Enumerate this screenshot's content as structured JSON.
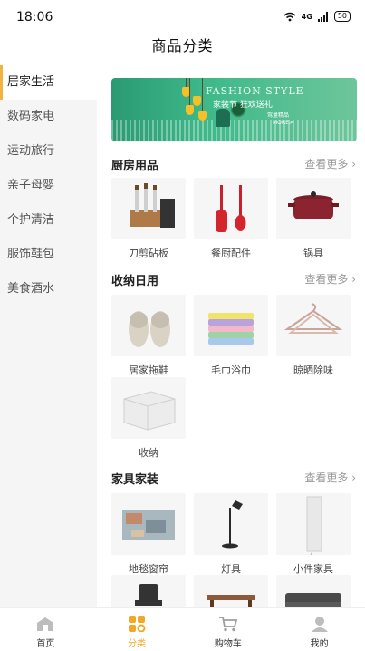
{
  "status_bar": {
    "time": "18:06",
    "signal_text": "4G",
    "battery": "50"
  },
  "header": {
    "title": "商品分类"
  },
  "sidebar": {
    "items": [
      {
        "label": "居家生活",
        "active": true
      },
      {
        "label": "数码家电",
        "active": false
      },
      {
        "label": "运动旅行",
        "active": false
      },
      {
        "label": "亲子母婴",
        "active": false
      },
      {
        "label": "个护清洁",
        "active": false
      },
      {
        "label": "服饰鞋包",
        "active": false
      },
      {
        "label": "美食酒水",
        "active": false
      }
    ]
  },
  "banner": {
    "title_en": "FASHION STYLE",
    "subtitle_cn": "家装节 狂欢送礼",
    "more_line1": "驾量精品",
    "more_line2": "MORE>"
  },
  "sections": [
    {
      "title": "厨房用品",
      "more": "查看更多",
      "items": [
        {
          "label": "刀剪砧板",
          "icon": "knife-set-icon"
        },
        {
          "label": "餐厨配件",
          "icon": "spatula-icon"
        },
        {
          "label": "锅具",
          "icon": "pot-icon"
        }
      ]
    },
    {
      "title": "收纳日用",
      "more": "查看更多",
      "items": [
        {
          "label": "居家拖鞋",
          "icon": "slippers-icon"
        },
        {
          "label": "毛巾浴巾",
          "icon": "towels-icon"
        },
        {
          "label": "晾晒除味",
          "icon": "hanger-icon"
        },
        {
          "label": "收纳",
          "icon": "storage-box-icon"
        }
      ]
    },
    {
      "title": "家具家装",
      "more": "查看更多",
      "items": [
        {
          "label": "地毯窗帘",
          "icon": "rug-icon"
        },
        {
          "label": "灯具",
          "icon": "lamp-icon"
        },
        {
          "label": "小件家具",
          "icon": "mirror-icon"
        }
      ]
    }
  ],
  "tabbar": {
    "items": [
      {
        "label": "首页",
        "icon": "home-icon",
        "active": false
      },
      {
        "label": "分类",
        "icon": "category-icon",
        "active": true
      },
      {
        "label": "购物车",
        "icon": "cart-icon",
        "active": false
      },
      {
        "label": "我的",
        "icon": "profile-icon",
        "active": false
      }
    ]
  },
  "colors": {
    "accent": "#f2a824",
    "sidebar_bg": "#f5f5f5",
    "banner_green": "#3fb98a"
  }
}
